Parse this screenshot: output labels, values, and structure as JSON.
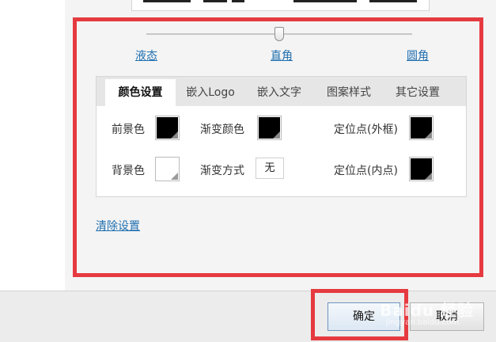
{
  "slider": {
    "left_label": "液态",
    "middle_label": "直角",
    "right_label": "圆角",
    "selected": "直角"
  },
  "tabs": [
    {
      "label": "颜色设置",
      "active": true
    },
    {
      "label": "嵌入Logo",
      "active": false
    },
    {
      "label": "嵌入文字",
      "active": false
    },
    {
      "label": "图案样式",
      "active": false
    },
    {
      "label": "其它设置",
      "active": false
    }
  ],
  "color_settings": {
    "foreground_label": "前景色",
    "foreground_color": "#000000",
    "background_label": "背景色",
    "background_color": "#ffffff",
    "gradient_color_label": "渐变颜色",
    "gradient_color": "#000000",
    "gradient_mode_label": "渐变方式",
    "gradient_mode_value": "无",
    "outer_eye_label": "定位点(外框)",
    "outer_eye_color": "#000000",
    "inner_eye_label": "定位点(内点)",
    "inner_eye_color": "#000000"
  },
  "clear_settings_label": "清除设置",
  "footer": {
    "ok_label": "确定",
    "cancel_label": "取消"
  },
  "watermark": {
    "text": "Baidu 经验",
    "sub": "jingyan.baidu.com"
  },
  "colors": {
    "highlight": "#e53a40",
    "link": "#1f6fb0"
  }
}
